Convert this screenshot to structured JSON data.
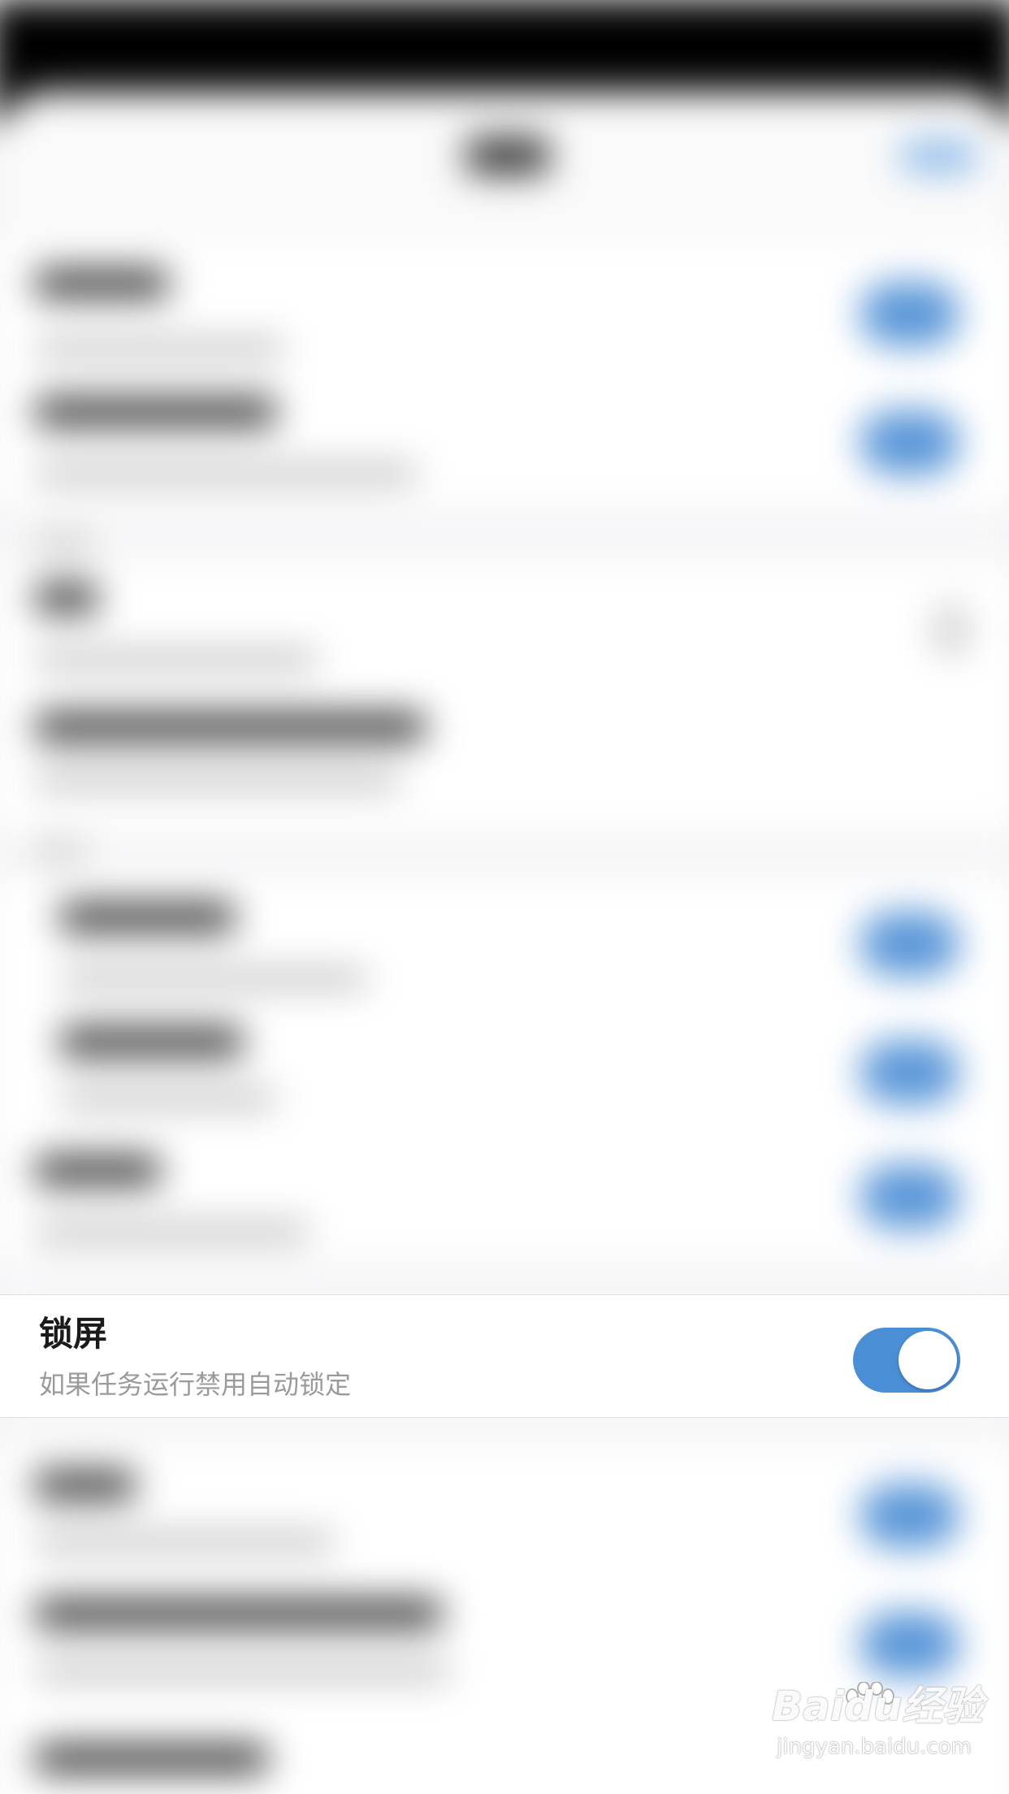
{
  "lock_screen_row": {
    "title": "锁屏",
    "subtitle": "如果任务运行禁用自动锁定",
    "toggle_on": true
  },
  "colors": {
    "accent": "#4a8fd6",
    "row_background": "#ffffff",
    "subtitle_text": "#9a9a9a"
  },
  "watermark": {
    "brand": "Baidu经验",
    "url": "jingyan.baidu.com"
  }
}
